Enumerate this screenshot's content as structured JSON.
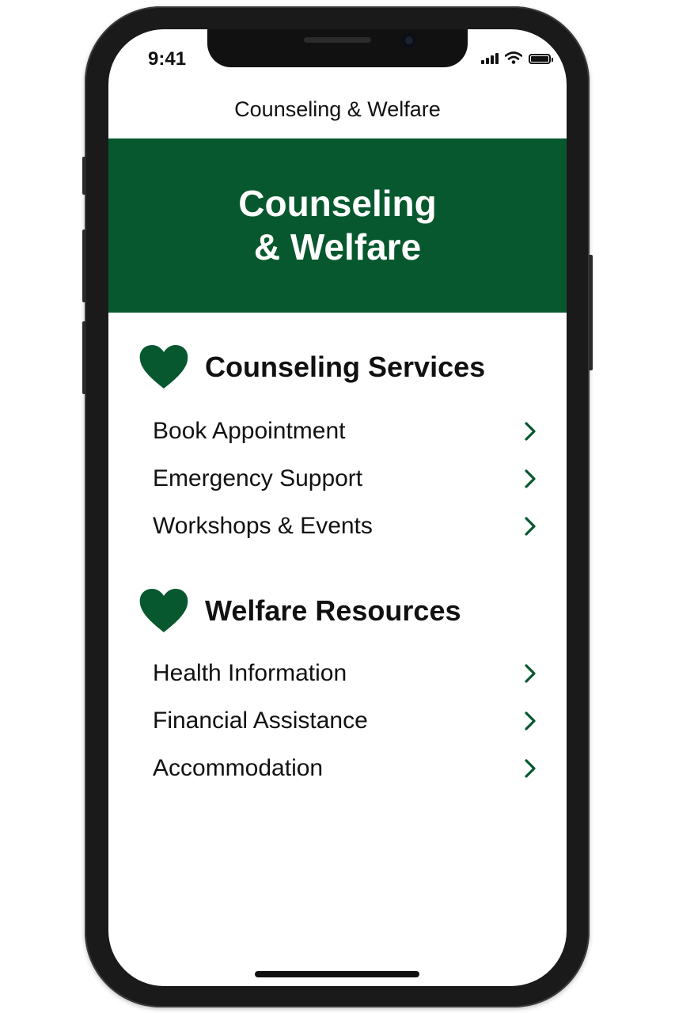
{
  "status_bar": {
    "time": "9:41",
    "icons": [
      "cellular-signal-icon",
      "wifi-icon",
      "battery-icon"
    ]
  },
  "nav": {
    "title": "Counseling & Welfare"
  },
  "hero": {
    "title": "Counseling\n& Welfare",
    "background_color": "#07582e"
  },
  "sections": [
    {
      "title": "Counseling Services",
      "icon": "heart-icon",
      "items": [
        {
          "label": "Book Appointment",
          "icon": "chevron-right-icon"
        },
        {
          "label": "Emergency Support",
          "icon": "chevron-right-icon"
        },
        {
          "label": "Workshops & Events",
          "icon": "chevron-right-icon"
        }
      ]
    },
    {
      "title": "Welfare Resources",
      "icon": "heart-icon",
      "items": [
        {
          "label": "Health Information",
          "icon": "chevron-right-icon"
        },
        {
          "label": "Financial Assistance",
          "icon": "chevron-right-icon"
        },
        {
          "label": "Accommodation",
          "icon": "chevron-right-icon"
        }
      ]
    }
  ],
  "colors": {
    "accent": "#07582e",
    "text": "#111111",
    "background": "#ffffff"
  }
}
